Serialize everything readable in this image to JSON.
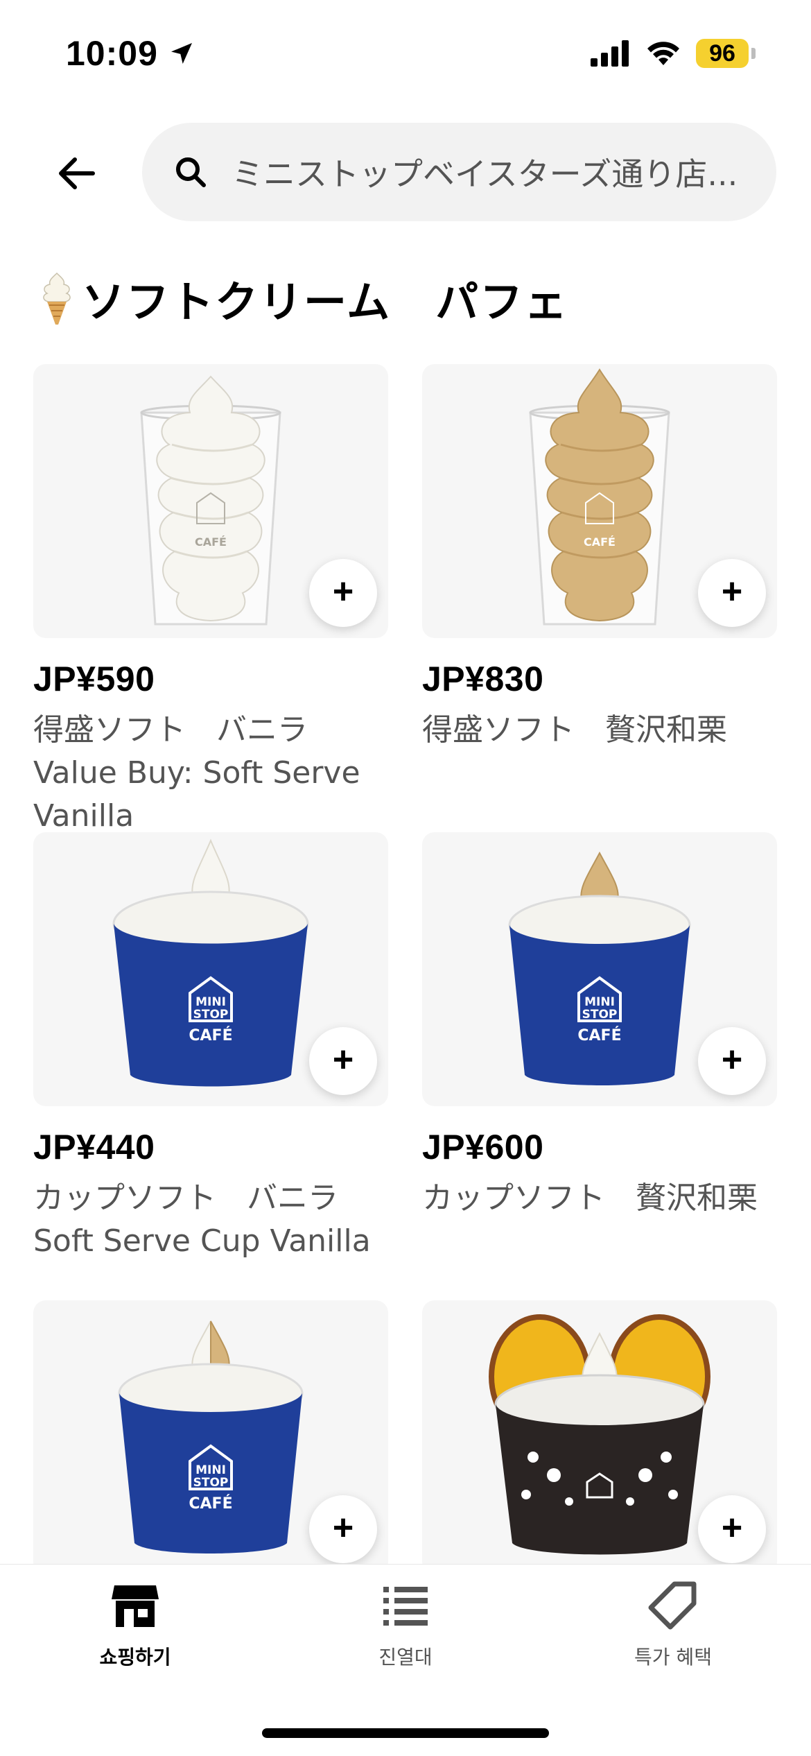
{
  "status_bar": {
    "time": "10:09",
    "battery": "96"
  },
  "header": {
    "search_text": "ミニストップベイスターズ通り店..."
  },
  "section": {
    "title": "ソフトクリーム　パフェ",
    "icon": "soft-serve-cone-icon"
  },
  "products": [
    {
      "price": "JP¥590",
      "name": "得盛ソフト　バニラ Value Buy: Soft Serve Vanilla",
      "add_label": "+"
    },
    {
      "price": "JP¥830",
      "name": "得盛ソフト　贅沢和栗",
      "add_label": "+"
    },
    {
      "price": "JP¥440",
      "name": "カップソフト　バニラ Soft Serve Cup Vanilla",
      "add_label": "+"
    },
    {
      "price": "JP¥600",
      "name": "カップソフト　贅沢和栗",
      "add_label": "+"
    },
    {
      "price": "",
      "name": "",
      "add_label": "+"
    },
    {
      "price": "",
      "name": "",
      "add_label": "+"
    }
  ],
  "product_image_text": "MINI STOP CAFÉ",
  "bottom_nav": [
    {
      "label": "쇼핑하기",
      "icon": "store-icon",
      "active": true
    },
    {
      "label": "진열대",
      "icon": "list-icon",
      "active": false
    },
    {
      "label": "특가 혜택",
      "icon": "tag-icon",
      "active": false
    }
  ],
  "colors": {
    "vanilla": "#f7f6f1",
    "chestnut": "#d6b47c",
    "cup_blue": "#1f3f9a",
    "cup_black": "#2a2423",
    "sweet_potato": "#f0b61c",
    "battery": "#f5d02f"
  }
}
